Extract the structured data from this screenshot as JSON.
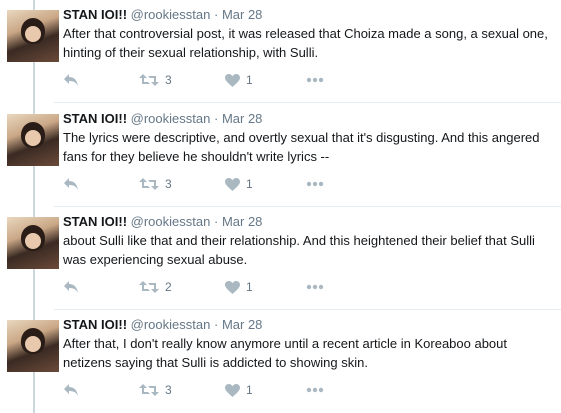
{
  "tweets": [
    {
      "name": "STAN IOI!!",
      "handle": "@rookiesstan",
      "date": "Mar 28",
      "text": "After that controversial post, it was released that Choiza made a song, a sexual one, hinting of their sexual relationship, with Sulli.",
      "retweets": "3",
      "likes": "1"
    },
    {
      "name": "STAN IOI!!",
      "handle": "@rookiesstan",
      "date": "Mar 28",
      "text": "The lyrics were descriptive, and overtly sexual that it's disgusting. And this angered fans for they believe he shouldn't write lyrics --",
      "retweets": "3",
      "likes": "1"
    },
    {
      "name": "STAN IOI!!",
      "handle": "@rookiesstan",
      "date": "Mar 28",
      "text": "about Sulli like that and their relationship. And this heightened their belief that Sulli was experiencing sexual abuse.",
      "retweets": "2",
      "likes": "1"
    },
    {
      "name": "STAN IOI!!",
      "handle": "@rookiesstan",
      "date": "Mar 28",
      "text": "After that, I don't really know anymore until a recent article in Koreaboo about netizens saying that Sulli is addicted to showing skin.",
      "retweets": "3",
      "likes": "1"
    }
  ],
  "separator": "·",
  "icons": {
    "reply": "reply-icon",
    "retweet": "retweet-icon",
    "like": "heart-icon",
    "more": "more-dots-icon"
  },
  "colors": {
    "text": "#14171a",
    "muted": "#657786",
    "icon": "#aab8c2",
    "thread_line": "#ccd6dd"
  }
}
